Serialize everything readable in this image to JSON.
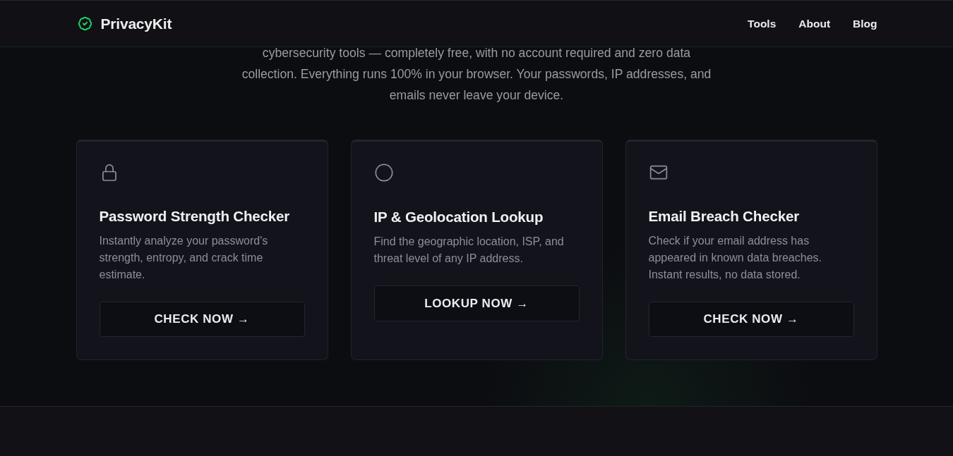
{
  "header": {
    "brand": "PrivacyKit",
    "nav": [
      "Tools",
      "About",
      "Blog"
    ]
  },
  "intro": {
    "text": "cybersecurity tools — completely free, with no account required and zero data collection. Everything runs 100% in your browser. Your passwords, IP addresses, and emails never leave your device."
  },
  "tools": [
    {
      "title": "Password Strength Checker",
      "description": "Instantly analyze your password's strength, entropy, and crack time estimate.",
      "button": "CHECK NOW →"
    },
    {
      "title": "IP & Geolocation Lookup",
      "description": "Find the geographic location, ISP, and threat level of any IP address.",
      "button": "LOOKUP NOW →"
    },
    {
      "title": "Email Breach Checker",
      "description": "Check if your email address has appeared in known data breaches. Instant results, no data stored.",
      "button": "CHECK NOW →"
    }
  ]
}
